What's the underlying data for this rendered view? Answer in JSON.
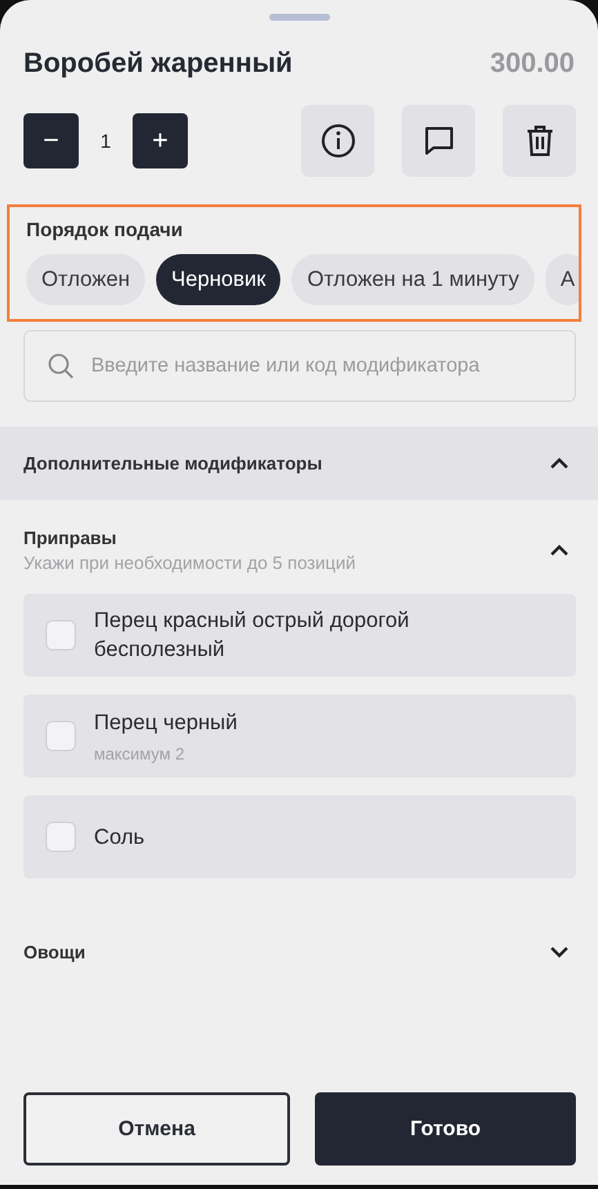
{
  "item": {
    "title": "Воробей жаренный",
    "price": "300.00",
    "quantity": "1",
    "decrement": "−",
    "increment": "+"
  },
  "serving": {
    "title": "Порядок подачи",
    "highlighted": true,
    "options": [
      {
        "label": "Отложен",
        "selected": false
      },
      {
        "label": "Черновик",
        "selected": true
      },
      {
        "label": "Отложен на 1 минуту",
        "selected": false
      },
      {
        "label": "А",
        "selected": false
      }
    ]
  },
  "search": {
    "placeholder": "Введите название или код модификатора"
  },
  "groups": [
    {
      "kind": "band",
      "title": "Дополнительные модификаторы",
      "expanded": true
    },
    {
      "kind": "group",
      "title": "Приправы",
      "subtitle": "Укажи при необходимости до 5 позиций",
      "expanded": true,
      "items": [
        {
          "label": "Перец красный острый дорогой бесполезный",
          "checked": false
        },
        {
          "label": "Перец черный",
          "note": "максимум 2",
          "checked": false
        },
        {
          "label": "Соль",
          "checked": false
        }
      ]
    },
    {
      "kind": "group",
      "title": "Овощи",
      "expanded": false
    }
  ],
  "buttons": [
    {
      "label": "Отмена",
      "kind": "secondary"
    },
    {
      "label": "Готово",
      "kind": "primary"
    }
  ]
}
